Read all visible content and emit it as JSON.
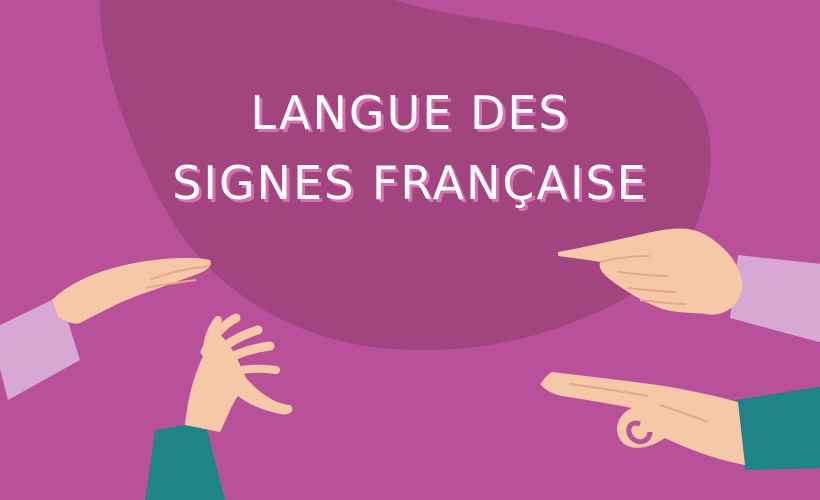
{
  "banner": {
    "title_line1": "LANGUE DES",
    "title_line2": "SIGNES FRANÇAISE"
  },
  "colors": {
    "background": "#b9519a",
    "blob": "#a2447f",
    "skin": "#f6c8a8",
    "skin_shadow": "#e6a889",
    "sleeve_lilac": "#d7a8d4",
    "sleeve_teal": "#1e8488",
    "title_text": "#ffffff",
    "title_shadow": "#d76fb1"
  },
  "illustration": {
    "hands": [
      "open-palm-hand-icon",
      "claw-hand-icon",
      "pointing-hand-icon",
      "pinch-hand-icon"
    ]
  }
}
